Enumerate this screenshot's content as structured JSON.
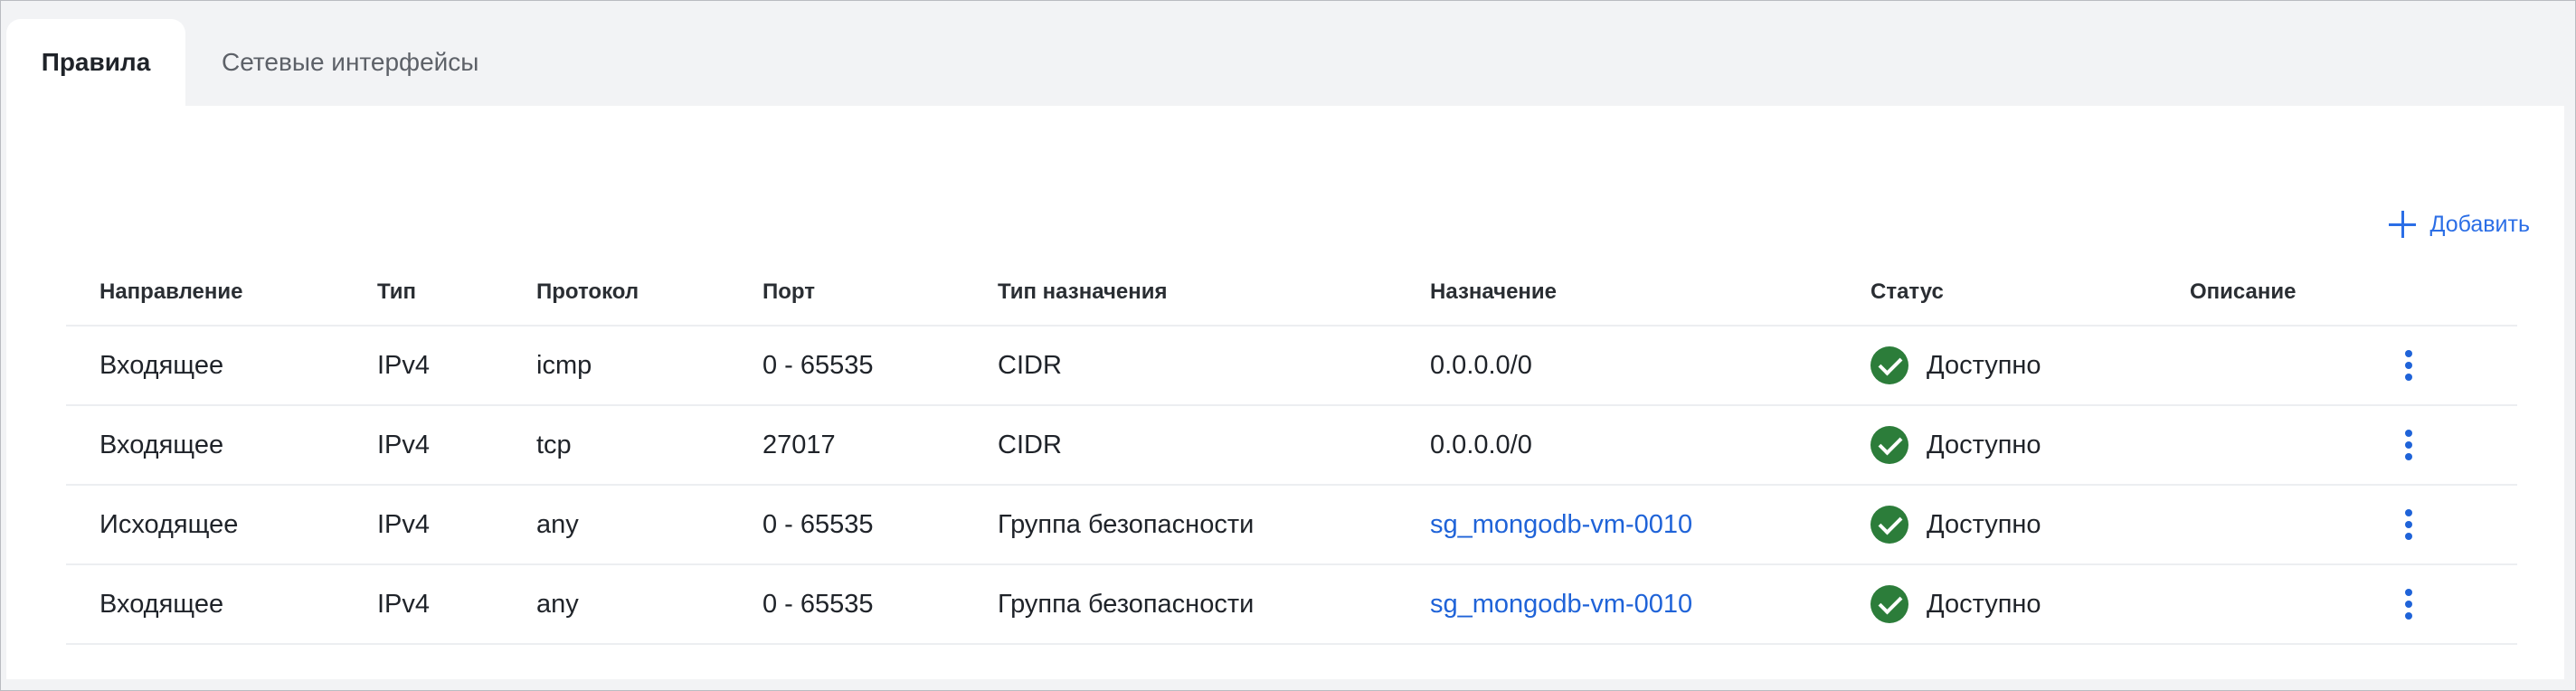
{
  "tabs": [
    {
      "label": "Правила",
      "active": true
    },
    {
      "label": "Сетевые интерфейсы",
      "active": false
    }
  ],
  "toolbar": {
    "add_label": "Добавить",
    "add_icon": "plus-icon"
  },
  "table": {
    "headers": {
      "direction": "Направление",
      "type": "Тип",
      "protocol": "Протокол",
      "port": "Порт",
      "destination_type": "Тип назначения",
      "destination": "Назначение",
      "status": "Статус",
      "description": "Описание"
    },
    "rows": [
      {
        "direction": "Входящее",
        "type": "IPv4",
        "protocol": "icmp",
        "port": "0 - 65535",
        "destination_type": "CIDR",
        "destination": "0.0.0.0/0",
        "destination_is_link": false,
        "status": "Доступно",
        "description": ""
      },
      {
        "direction": "Входящее",
        "type": "IPv4",
        "protocol": "tcp",
        "port": "27017",
        "destination_type": "CIDR",
        "destination": "0.0.0.0/0",
        "destination_is_link": false,
        "status": "Доступно",
        "description": ""
      },
      {
        "direction": "Исходящее",
        "type": "IPv4",
        "protocol": "any",
        "port": "0 - 65535",
        "destination_type": "Группа безопасности",
        "destination": "sg_mongodb-vm-0010",
        "destination_is_link": true,
        "status": "Доступно",
        "description": ""
      },
      {
        "direction": "Входящее",
        "type": "IPv4",
        "protocol": "any",
        "port": "0 - 65535",
        "destination_type": "Группа безопасности",
        "destination": "sg_mongodb-vm-0010",
        "destination_is_link": true,
        "status": "Доступно",
        "description": ""
      }
    ]
  },
  "colors": {
    "accent": "#1f63d8",
    "status_ok": "#2c7d3a",
    "page_bg": "#f2f3f5",
    "panel_bg": "#ffffff"
  }
}
